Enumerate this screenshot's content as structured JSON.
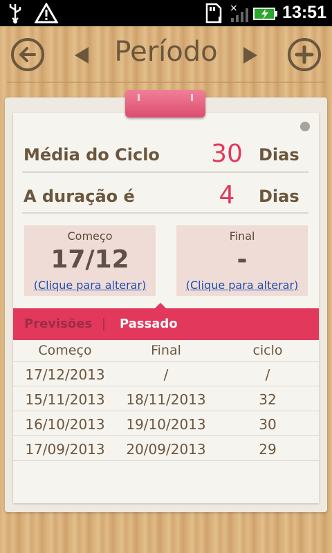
{
  "status_bar": {
    "time": "13:51",
    "icons": [
      "usb-icon",
      "warning-icon",
      "sd-card-icon",
      "signal-icon",
      "battery-icon"
    ]
  },
  "header": {
    "title": "Período",
    "back_icon": "back-arrow-icon",
    "add_icon": "plus-icon",
    "prev_icon": "caret-left-icon",
    "next_icon": "caret-right-icon"
  },
  "stats": {
    "cycle_average": {
      "label": "Média do Ciclo",
      "value": "30",
      "unit": "Dias"
    },
    "duration": {
      "label": "A duração é",
      "value": "4",
      "unit": "Dias"
    }
  },
  "start_box": {
    "title": "Começo",
    "value": "17/12",
    "link": "(Clique para alterar)"
  },
  "end_box": {
    "title": "Final",
    "value": "-",
    "link": "(Clique para alterar)"
  },
  "tabs": {
    "previsoes": "Previsões",
    "separator": "|",
    "passado": "Passado",
    "active": "Passado"
  },
  "table": {
    "headers": [
      "Começo",
      "Final",
      "ciclo"
    ],
    "rows": [
      [
        "17/12/2013",
        "/",
        "/"
      ],
      [
        "15/11/2013",
        "18/11/2013",
        "32"
      ],
      [
        "16/10/2013",
        "19/10/2013",
        "30"
      ],
      [
        "17/09/2013",
        "20/09/2013",
        "29"
      ]
    ]
  },
  "colors": {
    "accent": "#e2385c",
    "brown_text": "#6b563e",
    "link": "#1d4fb0",
    "date_box_bg": "#f0dcd6"
  }
}
